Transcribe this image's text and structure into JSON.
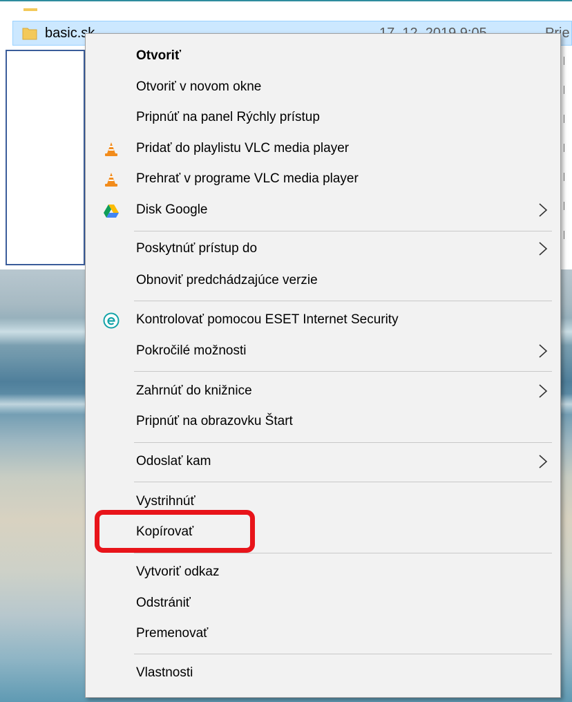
{
  "explorer": {
    "file": {
      "name": "basic.sk",
      "date": "17. 12. 2019 9:05",
      "type": "Prie"
    }
  },
  "context_menu": {
    "items": [
      {
        "label": "Otvoriť",
        "bold": true
      },
      {
        "label": "Otvoriť v novom okne"
      },
      {
        "label": "Pripnúť na panel Rýchly prístup"
      },
      {
        "label": "Pridať do playlistu VLC media player",
        "icon": "vlc-icon"
      },
      {
        "label": "Prehrať v programe VLC media player",
        "icon": "vlc-icon"
      },
      {
        "label": "Disk Google",
        "icon": "google-drive-icon",
        "submenu": true
      },
      {
        "label": "Poskytnúť prístup do",
        "submenu": true
      },
      {
        "label": "Obnoviť predchádzajúce verzie"
      },
      {
        "label": "Kontrolovať pomocou ESET Internet Security",
        "icon": "eset-icon"
      },
      {
        "label": "Pokročilé možnosti",
        "submenu": true
      },
      {
        "label": "Zahrnúť do knižnice",
        "submenu": true
      },
      {
        "label": "Pripnúť na obrazovku Štart"
      },
      {
        "label": "Odoslať kam",
        "submenu": true
      },
      {
        "label": "Vystrihnúť"
      },
      {
        "label": "Kopírovať",
        "highlighted": true
      },
      {
        "label": "Vytvoriť odkaz"
      },
      {
        "label": "Odstrániť"
      },
      {
        "label": "Premenovať"
      },
      {
        "label": "Vlastnosti"
      }
    ]
  },
  "colors": {
    "highlight": "#e8141a",
    "menu_bg": "#f2f2f2",
    "selection": "#cce8ff"
  }
}
